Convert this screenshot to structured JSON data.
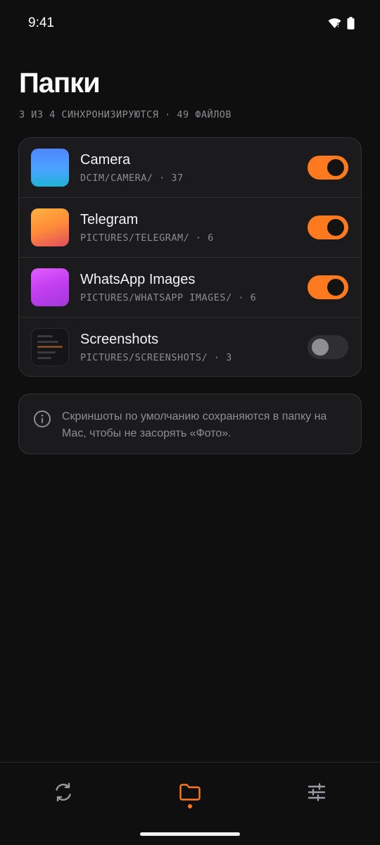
{
  "status_bar": {
    "time": "9:41"
  },
  "header": {
    "title": "Папки",
    "subtitle": "3 ИЗ 4 СИНХРОНИЗИРУЮТСЯ · 49 ФАЙЛОВ"
  },
  "folders": [
    {
      "name": "Camera",
      "path": "DCIM/CAMERA/ · 37",
      "enabled": true
    },
    {
      "name": "Telegram",
      "path": "PICTURES/TELEGRAM/ · 6",
      "enabled": true
    },
    {
      "name": "WhatsApp Images",
      "path": "PICTURES/WHATSAPP IMAGES/ · 6",
      "enabled": true
    },
    {
      "name": "Screenshots",
      "path": "PICTURES/SCREENSHOTS/ · 3",
      "enabled": false
    }
  ],
  "info": {
    "icon": "info-icon",
    "text": "Скриншоты по умолчанию сохраняются в папку на Mac, чтобы не засорять «Фото»."
  },
  "bottom_nav": {
    "items": [
      {
        "icon": "sync-icon",
        "active": false
      },
      {
        "icon": "folder-icon",
        "active": true
      },
      {
        "icon": "sliders-icon",
        "active": false
      }
    ]
  },
  "colors": {
    "accent": "#ff7a1f",
    "background": "#0f0f10",
    "card": "#1b1b1e",
    "muted_text": "#8e8e93"
  }
}
